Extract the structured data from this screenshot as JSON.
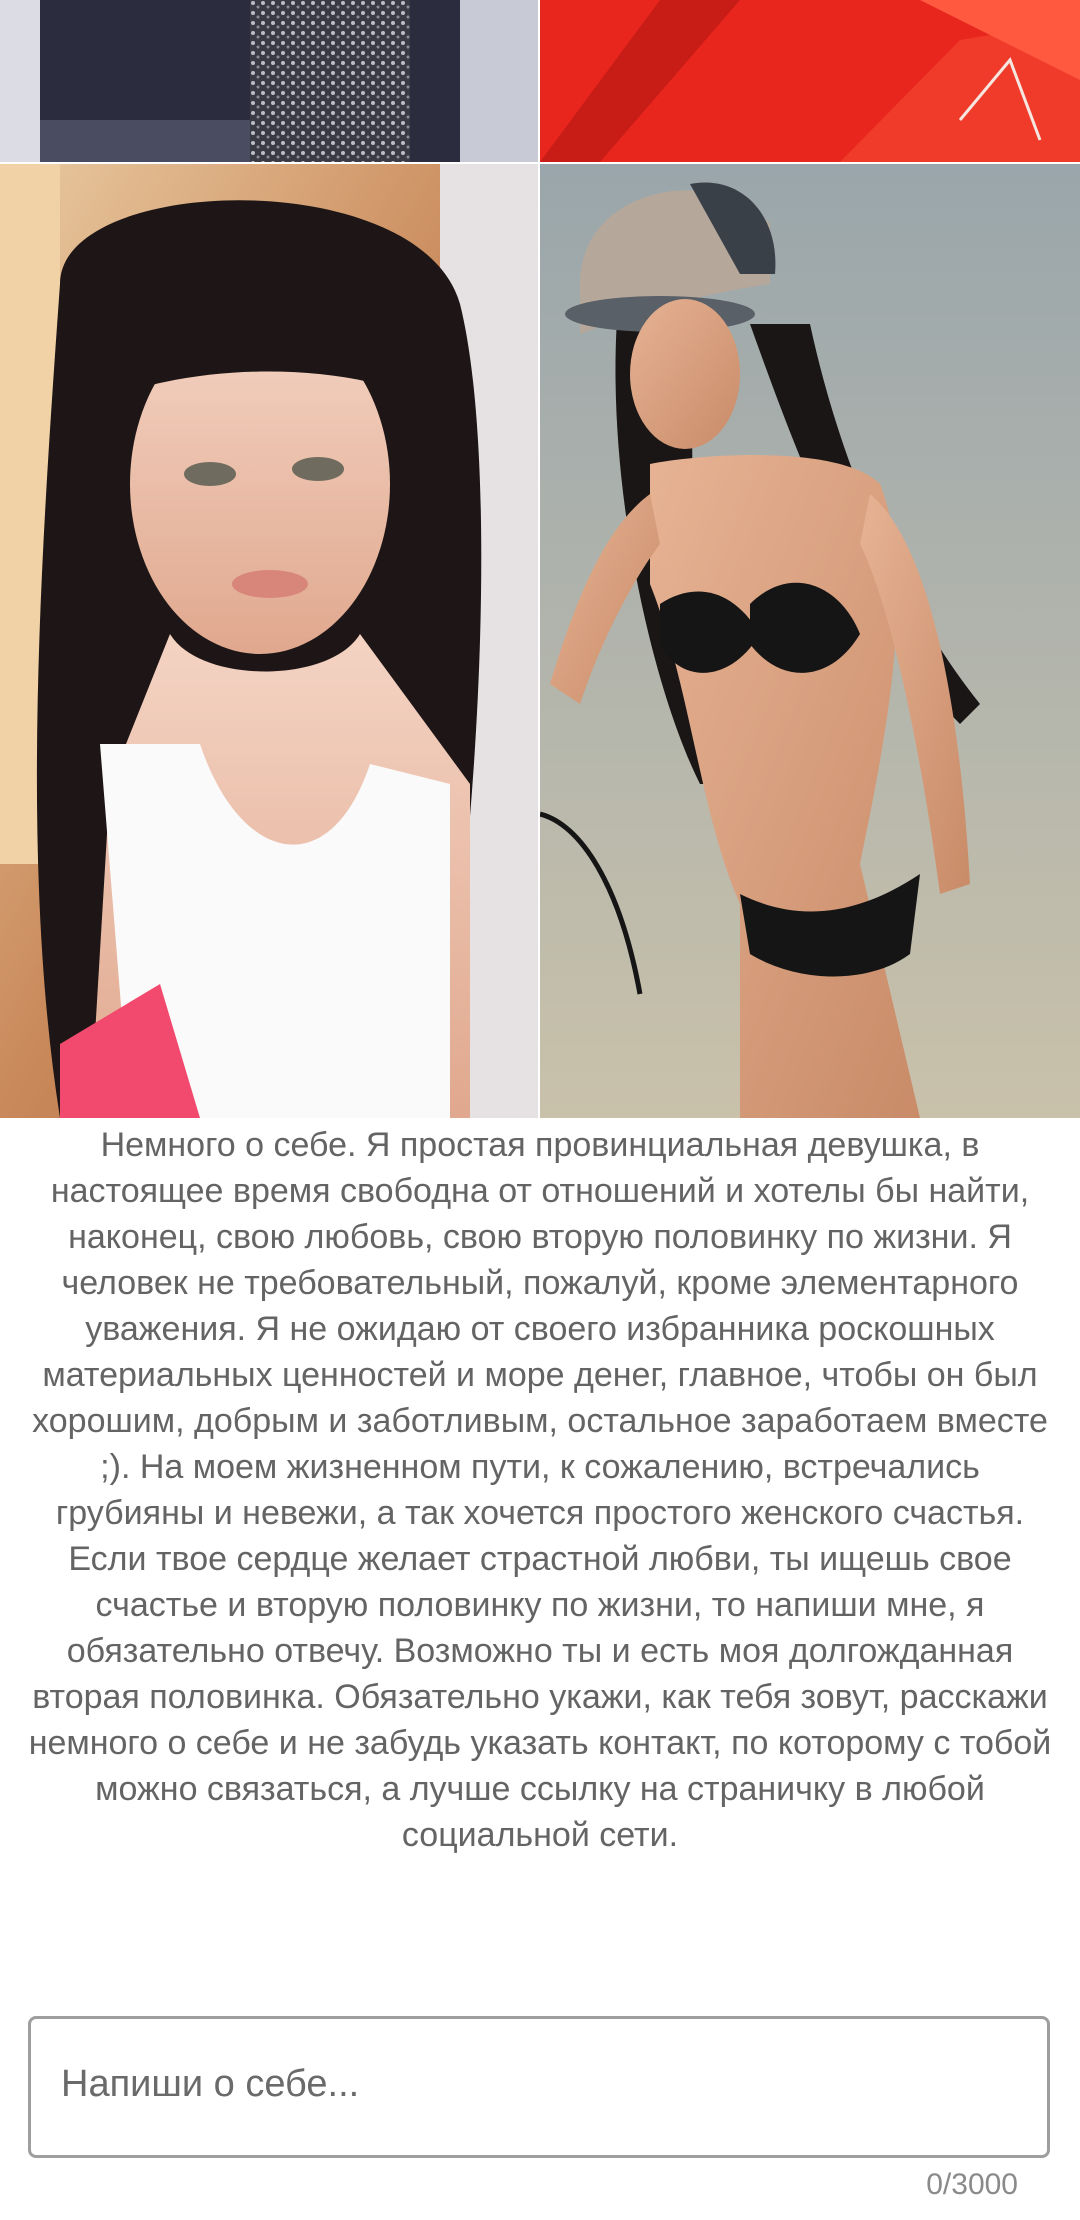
{
  "photos": [
    {
      "icon": "photo-sequin-dress-crop"
    },
    {
      "icon": "photo-red-fabric-crop"
    },
    {
      "icon": "photo-selfie-white-top"
    },
    {
      "icon": "photo-beach-black-swimsuit"
    }
  ],
  "bio": {
    "paragraph1": "Немного о себе. Я простая провинциальная девушка, в настоящее время свободна от отношений и хотелы бы найти, наконец, свою любовь, свою вторую половинку по жизни. Я человек не требовательный, пожалуй, кроме элементарного уважения. Я не ожидаю от своего избранника роскошных материальных ценностей и море денег, главное, чтобы он был хорошим, добрым и заботливым, остальное заработаем вместе ;). На моем жизненном пути, к сожалению, встречались грубияны и невежи, а так хочется простого женского счастья.",
    "paragraph2": "Если твое сердце желает страстной любви, ты ищешь свое счастье и вторую половинку по жизни, то напиши мне, я обязательно отвечу. Возможно ты и есть моя долгожданная вторая половинка. Обязательно укажи, как тебя зовут, расскажи немного о себе и не забудь указать контакт, по которому с тобой можно связаться, а лучше ссылку на страничку в любой социальной сети."
  },
  "message_input": {
    "value": "",
    "placeholder": "Напиши о себе..."
  },
  "char_counter": "0/3000",
  "colors": {
    "text": "#646464",
    "border": "#9e9e9e"
  }
}
